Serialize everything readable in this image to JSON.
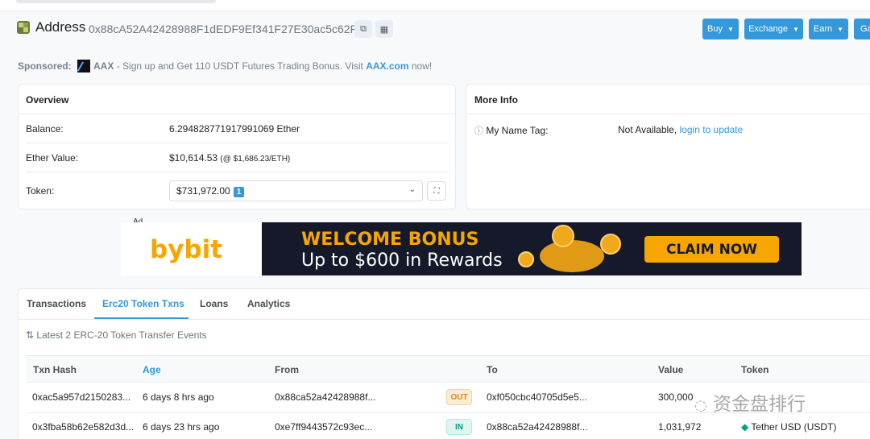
{
  "header": {
    "title": "Address",
    "address": "0x88cA52A42428988F1dEDF9Ef341F27E30ac5c62F",
    "buttons": [
      "Buy",
      "Exchange",
      "Earn",
      "Ga"
    ]
  },
  "sponsored": {
    "label": "Sponsored:",
    "brand": "AAX",
    "text": " - Sign up and Get 110 USDT Futures Trading Bonus. Visit ",
    "link": "AAX.com",
    "suffix": " now!"
  },
  "overview": {
    "title": "Overview",
    "balance_label": "Balance:",
    "balance_value": "6.294828771917991069 Ether",
    "ether_value_label": "Ether Value:",
    "ether_value": "$10,614.53",
    "ether_rate": "(@ $1,686.23/ETH)",
    "token_label": "Token:",
    "token_value": "$731,972.00",
    "token_count": "1"
  },
  "more_info": {
    "title": "More Info",
    "name_tag_label": "My Name Tag:",
    "name_tag_value": "Not Available,",
    "name_tag_link": "login to update"
  },
  "ad": {
    "label": "Ad",
    "brand": "bybit",
    "headline": "WELCOME BONUS",
    "subline": "Up to $600 in Rewards",
    "cta": "CLAIM NOW"
  },
  "tabs": [
    "Transactions",
    "Erc20 Token Txns",
    "Loans",
    "Analytics"
  ],
  "active_tab": 1,
  "events_summary": "Latest 2 ERC-20 Token Transfer Events",
  "table": {
    "headers": [
      "Txn Hash",
      "Age",
      "From",
      "",
      "To",
      "Value",
      "Token"
    ],
    "rows": [
      {
        "hash": "0xac5a957d2150283...",
        "age": "6 days 8 hrs ago",
        "from": "0x88ca52a42428988f...",
        "dir": "OUT",
        "to": "0xf050cbc40705d5e5...",
        "value": "300,000",
        "token": ""
      },
      {
        "hash": "0x3fba58b62e582d3d...",
        "age": "6 days 23 hrs ago",
        "from": "0xe7ff9443572c93ec...",
        "dir": "IN",
        "to": "0x88ca52a42428988f...",
        "value": "1,031,972",
        "token": "Tether USD (USDT)"
      }
    ]
  },
  "watermark": "资金盘排行",
  "colors": {
    "accent": "#3498db",
    "out": "#d98b1b",
    "in": "#00a186",
    "bybit": "#f7a600"
  }
}
